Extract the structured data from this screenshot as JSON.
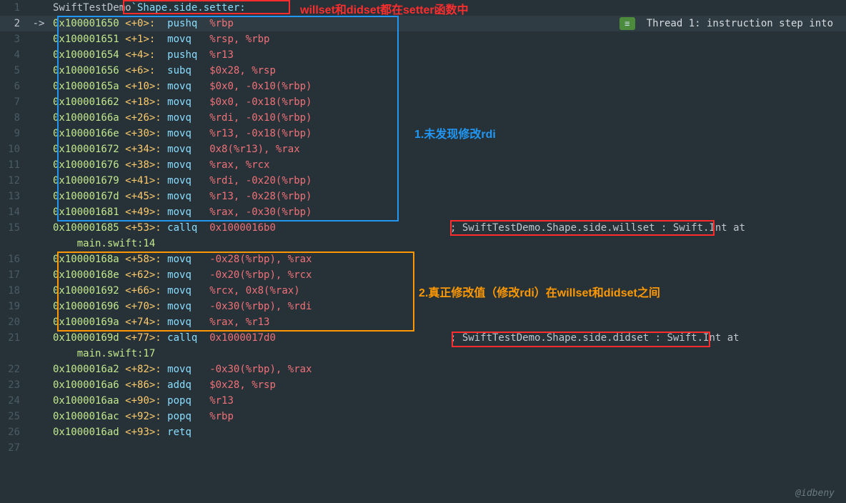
{
  "header": {
    "prefix": "SwiftTestDemo",
    "funcname": "`Shape.side.setter:"
  },
  "thread_badge": {
    "icon": "≡",
    "text": "Thread 1: instruction step into"
  },
  "arrow": "->",
  "watermark": "@idbeny",
  "annotations": {
    "top_red": "willset和didset都在setter函数中",
    "mid_blue": "1.未发现修改rdi",
    "mid_orange": "2.真正修改值（修改rdi）在willset和didset之间"
  },
  "comments": {
    "willset": "SwiftTestDemo.Shape.side.willset",
    "didset": "SwiftTestDemo.Shape.side.didset",
    "tail": " : Swift.Int at"
  },
  "continuations": {
    "c15": "main.swift:14",
    "c21": "main.swift:17"
  },
  "lines": {
    "l2": {
      "addr": "0x100001650",
      "off": "<+0>:",
      "mn": "pushq",
      "op": "%rbp"
    },
    "l3": {
      "addr": "0x100001651",
      "off": "<+1>:",
      "mn": "movq",
      "op": "%rsp, %rbp"
    },
    "l4": {
      "addr": "0x100001654",
      "off": "<+4>:",
      "mn": "pushq",
      "op": "%r13"
    },
    "l5": {
      "addr": "0x100001656",
      "off": "<+6>:",
      "mn": "subq",
      "op": "$0x28, %rsp"
    },
    "l6": {
      "addr": "0x10000165a",
      "off": "<+10>:",
      "mn": "movq",
      "op": "$0x0, -0x10(%rbp)"
    },
    "l7": {
      "addr": "0x100001662",
      "off": "<+18>:",
      "mn": "movq",
      "op": "$0x0, -0x18(%rbp)"
    },
    "l8": {
      "addr": "0x10000166a",
      "off": "<+26>:",
      "mn": "movq",
      "op": "%rdi, -0x10(%rbp)"
    },
    "l9": {
      "addr": "0x10000166e",
      "off": "<+30>:",
      "mn": "movq",
      "op": "%r13, -0x18(%rbp)"
    },
    "l10": {
      "addr": "0x100001672",
      "off": "<+34>:",
      "mn": "movq",
      "op": "0x8(%r13), %rax"
    },
    "l11": {
      "addr": "0x100001676",
      "off": "<+38>:",
      "mn": "movq",
      "op": "%rax, %rcx"
    },
    "l12": {
      "addr": "0x100001679",
      "off": "<+41>:",
      "mn": "movq",
      "op": "%rdi, -0x20(%rbp)"
    },
    "l13": {
      "addr": "0x10000167d",
      "off": "<+45>:",
      "mn": "movq",
      "op": "%r13, -0x28(%rbp)"
    },
    "l14": {
      "addr": "0x100001681",
      "off": "<+49>:",
      "mn": "movq",
      "op": "%rax, -0x30(%rbp)"
    },
    "l15": {
      "addr": "0x100001685",
      "off": "<+53>:",
      "mn": "callq",
      "op": "0x1000016b0"
    },
    "l16": {
      "addr": "0x10000168a",
      "off": "<+58>:",
      "mn": "movq",
      "op": "-0x28(%rbp), %rax"
    },
    "l17": {
      "addr": "0x10000168e",
      "off": "<+62>:",
      "mn": "movq",
      "op": "-0x20(%rbp), %rcx"
    },
    "l18": {
      "addr": "0x100001692",
      "off": "<+66>:",
      "mn": "movq",
      "op": "%rcx, 0x8(%rax)"
    },
    "l19": {
      "addr": "0x100001696",
      "off": "<+70>:",
      "mn": "movq",
      "op": "-0x30(%rbp), %rdi"
    },
    "l20": {
      "addr": "0x10000169a",
      "off": "<+74>:",
      "mn": "movq",
      "op": "%rax, %r13"
    },
    "l21": {
      "addr": "0x10000169d",
      "off": "<+77>:",
      "mn": "callq",
      "op": "0x1000017d0"
    },
    "l22": {
      "addr": "0x1000016a2",
      "off": "<+82>:",
      "mn": "movq",
      "op": "-0x30(%rbp), %rax"
    },
    "l23": {
      "addr": "0x1000016a6",
      "off": "<+86>:",
      "mn": "addq",
      "op": "$0x28, %rsp"
    },
    "l24": {
      "addr": "0x1000016aa",
      "off": "<+90>:",
      "mn": "popq",
      "op": "%r13"
    },
    "l25": {
      "addr": "0x1000016ac",
      "off": "<+92>:",
      "mn": "popq",
      "op": "%rbp"
    },
    "l26": {
      "addr": "0x1000016ad",
      "off": "<+93>:",
      "mn": "retq",
      "op": ""
    }
  }
}
